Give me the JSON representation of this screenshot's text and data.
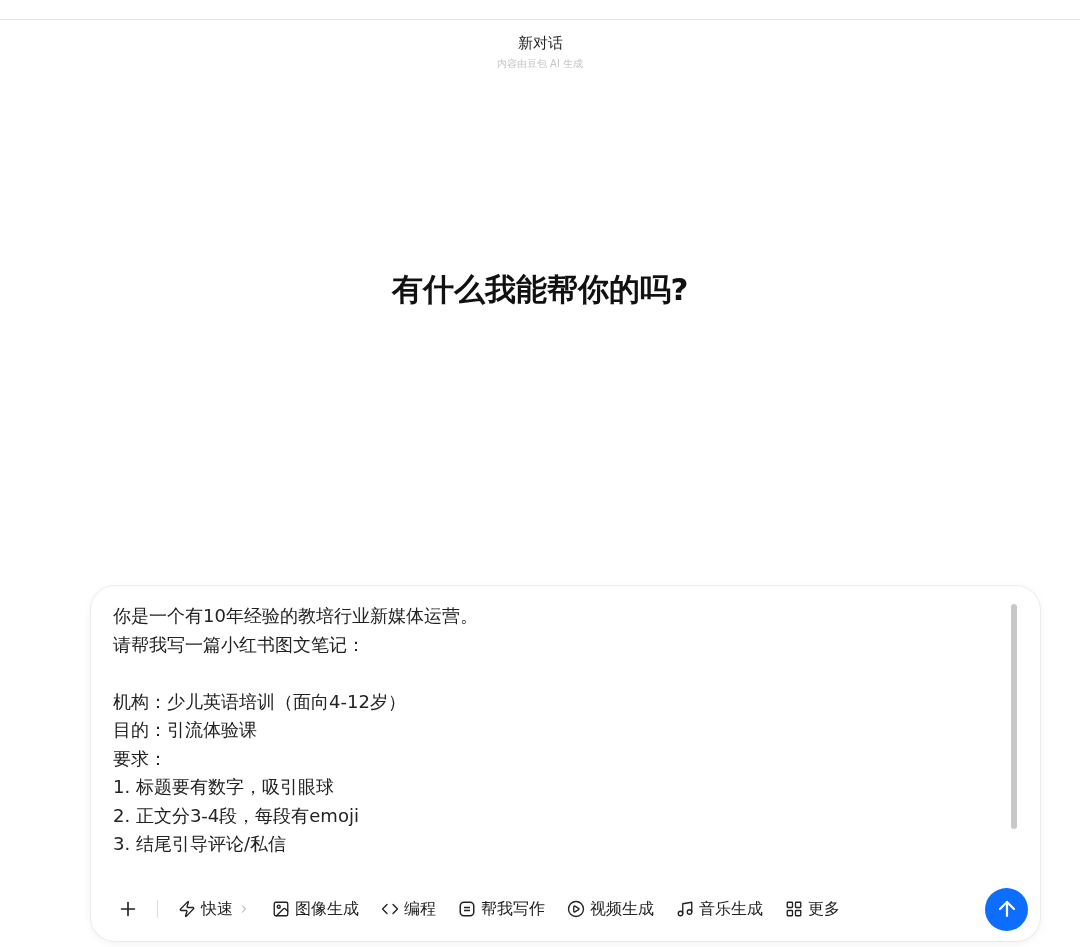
{
  "header": {
    "title": "新对话",
    "subtitle": "内容由豆包 AI 生成"
  },
  "greeting": "有什么我能帮你的吗?",
  "composer": {
    "paragraphs": [
      [
        "你是一个有10年经验的教培行业新媒体运营。",
        "请帮我写一篇小红书图文笔记："
      ],
      [
        "机构：少儿英语培训（面向4-12岁）",
        "目的：引流体验课",
        "要求：",
        "1. 标题要有数字，吸引眼球",
        "2. 正文分3-4段，每段有emoji",
        "3. 结尾引导评论/私信"
      ]
    ],
    "tools": [
      {
        "kind": "speed",
        "label": "快速"
      },
      {
        "kind": "image",
        "label": "图像生成"
      },
      {
        "kind": "code",
        "label": "编程"
      },
      {
        "kind": "write",
        "label": "帮我写作"
      },
      {
        "kind": "video",
        "label": "视频生成"
      },
      {
        "kind": "music",
        "label": "音乐生成"
      },
      {
        "kind": "more",
        "label": "更多"
      }
    ]
  }
}
